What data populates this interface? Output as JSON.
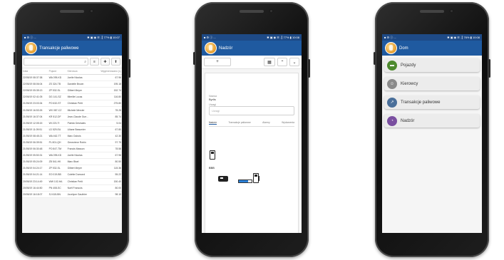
{
  "phones": [
    {
      "status": {
        "left": "■ ⚙ ⓘ ...",
        "right": "✱ ▣ ◉ ☰ .┃ 77% ▮ 10:07"
      },
      "title": "Transakcje paliwowe",
      "search_placeholder": "",
      "toolbar_icons": [
        "search-icon",
        "filter-icon",
        "add-icon",
        "export-icon"
      ],
      "columns": [
        "Data",
        "Pojazd",
        "Kierowca",
        "Wygenerowano (L)"
      ],
      "rows": [
        [
          "22/05/19 08:37:38",
          "WA 095-KD",
          "Joelle Nicolas",
          "67.96"
        ],
        [
          "22/05/19 08:06:04",
          "ZS 324-TB",
          "Danielle Brown",
          "195.18"
        ],
        [
          "22/05/19 05:35:13",
          "ZP 532-SL",
          "Gilbert Meyer",
          "152.74"
        ],
        [
          "22/05/19 02:41:05",
          "DG 141-SZ",
          "Mireille Lucas",
          "116.80"
        ],
        [
          "21/05/19 23:03:34",
          "PO 632-ST",
          "Christian Petit",
          "275.80"
        ],
        [
          "21/05/19 16:53:26",
          "WX 087-CZ",
          "Michele Mercier",
          "78.28"
        ],
        [
          "21/05/19 16:37:04",
          "KR 512-DF",
          "Jean-Claude Gue...",
          "85.74"
        ],
        [
          "21/05/19 12:05:15",
          "WI 223-TI",
          "Patrick Deshaies",
          "5.04"
        ],
        [
          "21/05/19 11:09:51",
          "LD 529-EA",
          "Liliane Beaumier",
          "67.80"
        ],
        [
          "21/05/19 08:45:21",
          "WA 462-TT",
          "Marc Dubois",
          "42.30"
        ],
        [
          "21/05/19 06:39:51",
          "PL 801-QH",
          "Genevieve Robin",
          "97.75"
        ],
        [
          "21/05/19 06:30:48",
          "PO 847-TM",
          "Francis Masson",
          "78.58"
        ],
        [
          "21/05/19 05:50:31",
          "WA 095-KD",
          "Joelle Nicolas",
          "67.96"
        ],
        [
          "21/05/19 05:24:09",
          "ZB 541-HK",
          "Marc Bisel",
          "80.50"
        ],
        [
          "21/05/19 04:24:17",
          "ZP 532-SL",
          "Gilbert Meyer",
          "115.36"
        ],
        [
          "21/05/19 04:21:14",
          "EO 019-BB",
          "Colette Dumond",
          "55.22"
        ],
        [
          "20/05/19 23:14:49",
          "WW 102-HA",
          "Christian Petit",
          "150.40"
        ],
        [
          "20/05/19 16:44:50",
          "PN 408-SC",
          "Noël Francois",
          "80.00"
        ],
        [
          "20/05/19 16:18:07",
          "SJ 615-BN",
          "Jocelyne Gauthier",
          "98.10"
        ]
      ]
    },
    {
      "status": {
        "left": "■ ⚙ ⓘ ...",
        "right": "✱ ▣ ◉ ☰ .┃ 77% ▮ 10:08"
      },
      "title": "Nadzór",
      "add_label": "+",
      "fields": {
        "name_label": "Nazwa",
        "name_value": "Byrlis",
        "desc_label": "Uwagi",
        "desc_placeholder": "Uwagi"
      },
      "tabs": [
        "Nadzór",
        "Transakcje paliwowe",
        "Alarmy",
        "Wydarzenia"
      ],
      "section_label": "BBB"
    },
    {
      "status": {
        "left": "■ ⚙ ⓘ ...",
        "right": "✱ ▣ ◉ ☰ .┃ 76% ▮ 10:08"
      },
      "title": "Dom",
      "menu": [
        {
          "label": "Pojazdy",
          "icon": "vehicle-icon",
          "color": "#4d8a2e"
        },
        {
          "label": "Kierowcy",
          "icon": "drivers-icon",
          "color": "#8a8a8a"
        },
        {
          "label": "Transakcje paliwowe",
          "icon": "chart-icon",
          "color": "#4a6f9a"
        },
        {
          "label": "Nadzór",
          "icon": "monitor-icon",
          "color": "#7a4fa0"
        }
      ]
    }
  ],
  "colors": {
    "appbar": "#1f5aa0",
    "statusbar": "#1e4a86"
  }
}
